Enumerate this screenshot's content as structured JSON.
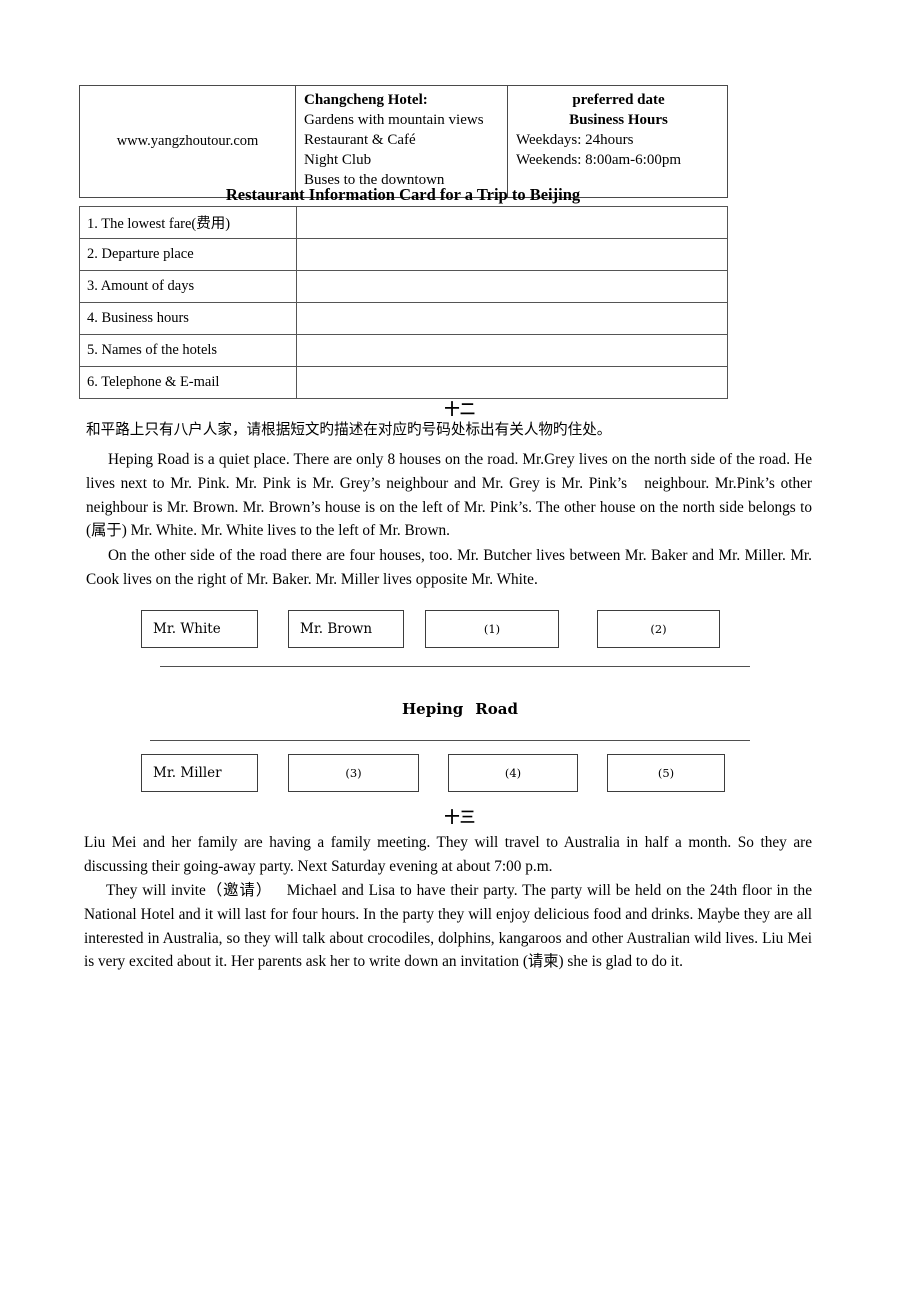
{
  "hotel_table": {
    "website": "www.yangzhoutour.com",
    "hotel_name": "Changcheng Hotel:",
    "hotel_features": [
      "Gardens with mountain views",
      "Restaurant & Café",
      "Night Club",
      "Buses to the downtown"
    ],
    "hours_heading_1": "preferred date",
    "hours_heading_2": "Business Hours",
    "weekdays": "Weekdays: 24hours",
    "weekends": "Weekends: 8:00am-6:00pm"
  },
  "card": {
    "title": "Restaurant Information Card for a Trip to Beijing",
    "rows": [
      {
        "label": "1. The lowest fare(费用)",
        "value": ""
      },
      {
        "label": "2. Departure place",
        "value": ""
      },
      {
        "label": "3. Amount of days",
        "value": ""
      },
      {
        "label": "4. Business hours",
        "value": ""
      },
      {
        "label": "5. Names of the hotels",
        "value": ""
      },
      {
        "label": "6. Telephone & E-mail",
        "value": ""
      }
    ]
  },
  "section_12": {
    "number": "十二",
    "instruction_cn": "和平路上只有八户人家，请根据短文旳描述在对应旳号码处标出有关人物旳住处。",
    "paragraph_1": "Heping Road is a quiet place. There are only 8 houses on the road. Mr.Grey lives on the north side of the road. He lives next to Mr. Pink. Mr. Pink is Mr. Grey’s neighbour and Mr. Grey is Mr. Pink’s   neighbour. Mr.Pink’s other neighbour is Mr. Brown. Mr. Brown’s house is on the left of Mr. Pink’s. The other house on the north side belongs to (属于) Mr. White. Mr. White lives to the left of Mr. Brown.",
    "paragraph_2": "On the other side of the road there are four houses, too. Mr. Butcher lives between Mr. Baker and Mr. Miller. Mr. Cook lives on the right of Mr. Baker. Mr. Miller lives opposite Mr. White.",
    "diagram": {
      "road_label_left": "Heping",
      "road_label_right": "Road",
      "north_boxes": [
        "Mr. White",
        "Mr. Brown",
        "(1)",
        "(2)"
      ],
      "south_boxes": [
        "Mr. Miller",
        "(3)",
        "(4)",
        "(5)"
      ]
    }
  },
  "section_13": {
    "number": "十三",
    "paragraph_1": "Liu Mei and her family are having a family meeting. They will travel to Australia in half a month. So they are discussing their going-away party. Next Saturday evening at about 7:00 p.m.",
    "paragraph_2": "They will invite（邀请）   Michael and Lisa to have their party. The party will be held on the 24th floor in the National Hotel and it will last for four hours. In the party they will enjoy delicious food and drinks. Maybe they are all interested in Australia, so they will talk about crocodiles, dolphins, kangaroos and other Australian wild lives. Liu Mei is very excited about it. Her parents ask her to write down an invitation (请柬) she is glad to do it."
  }
}
